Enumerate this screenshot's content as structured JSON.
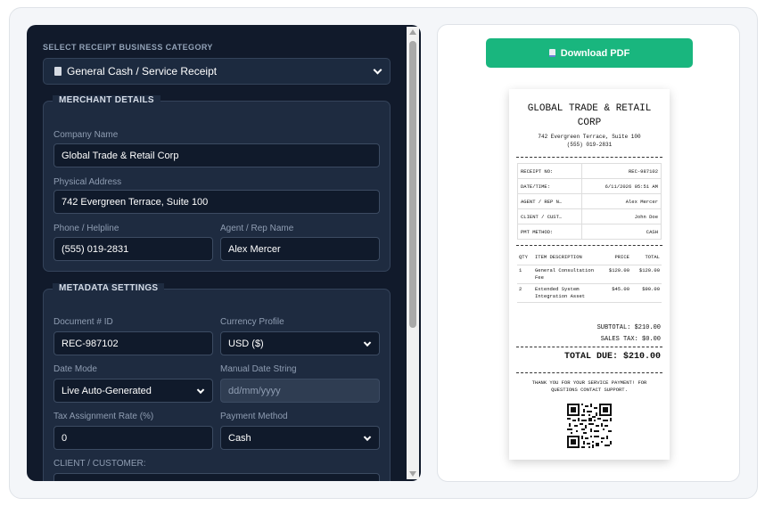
{
  "form": {
    "category_label": "SELECT RECEIPT BUSINESS CATEGORY",
    "category_value": "General Cash / Service Receipt",
    "merchant": {
      "title": "MERCHANT DETAILS",
      "company_label": "Company Name",
      "company_value": "Global Trade & Retail Corp",
      "address_label": "Physical Address",
      "address_value": "742 Evergreen Terrace, Suite 100",
      "phone_label": "Phone / Helpline",
      "phone_value": "(555) 019-2831",
      "agent_label": "Agent / Rep Name",
      "agent_value": "Alex Mercer"
    },
    "metadata": {
      "title": "METADATA SETTINGS",
      "doc_label": "Document # ID",
      "doc_value": "REC-987102",
      "currency_label": "Currency Profile",
      "currency_value": "USD ($)",
      "datemode_label": "Date Mode",
      "datemode_value": "Live Auto-Generated",
      "manualdate_label": "Manual Date String",
      "manualdate_placeholder": "dd/mm/yyyy",
      "tax_label": "Tax Assignment Rate (%)",
      "tax_value": "0",
      "payment_label": "Payment Method",
      "payment_value": "Cash",
      "client_label": "CLIENT / CUSTOMER:"
    }
  },
  "preview": {
    "download_label": "Download PDF",
    "receipt": {
      "company_line1": "GLOBAL TRADE & RETAIL",
      "company_line2": "CORP",
      "address": "742 Evergreen Terrace, Suite 100",
      "phone": "(555) 019-2831",
      "meta": [
        {
          "key": "RECEIPT NO:",
          "value": "REC-987102"
        },
        {
          "key": "DATE/TIME:",
          "value": "6/11/2026 05:51 AM"
        },
        {
          "key": "AGENT / REP N…",
          "value": "Alex Mercer"
        },
        {
          "key": "CLIENT / CUST…",
          "value": "John Doe"
        },
        {
          "key": "PMT METHOD:",
          "value": "CASH"
        }
      ],
      "headers": {
        "qty": "QTY",
        "desc": "ITEM DESCRIPTION",
        "price": "PRICE",
        "total": "TOTAL"
      },
      "items": [
        {
          "qty": "1",
          "desc": "General Consultation Fee",
          "price": "$120.00",
          "total": "$120.00"
        },
        {
          "qty": "2",
          "desc": "Extended System Integration Asset",
          "price": "$45.00",
          "total": "$90.00"
        }
      ],
      "subtotal": "SUBTOTAL: $210.00",
      "sales_tax": "SALES TAX: $0.00",
      "total_due": "TOTAL DUE: $210.00",
      "thanks": "THANK YOU FOR YOUR SERVICE PAYMENT! FOR QUESTIONS CONTACT SUPPORT."
    }
  },
  "colors": {
    "panel_bg": "#111a2b",
    "accent_green": "#19b67e"
  }
}
